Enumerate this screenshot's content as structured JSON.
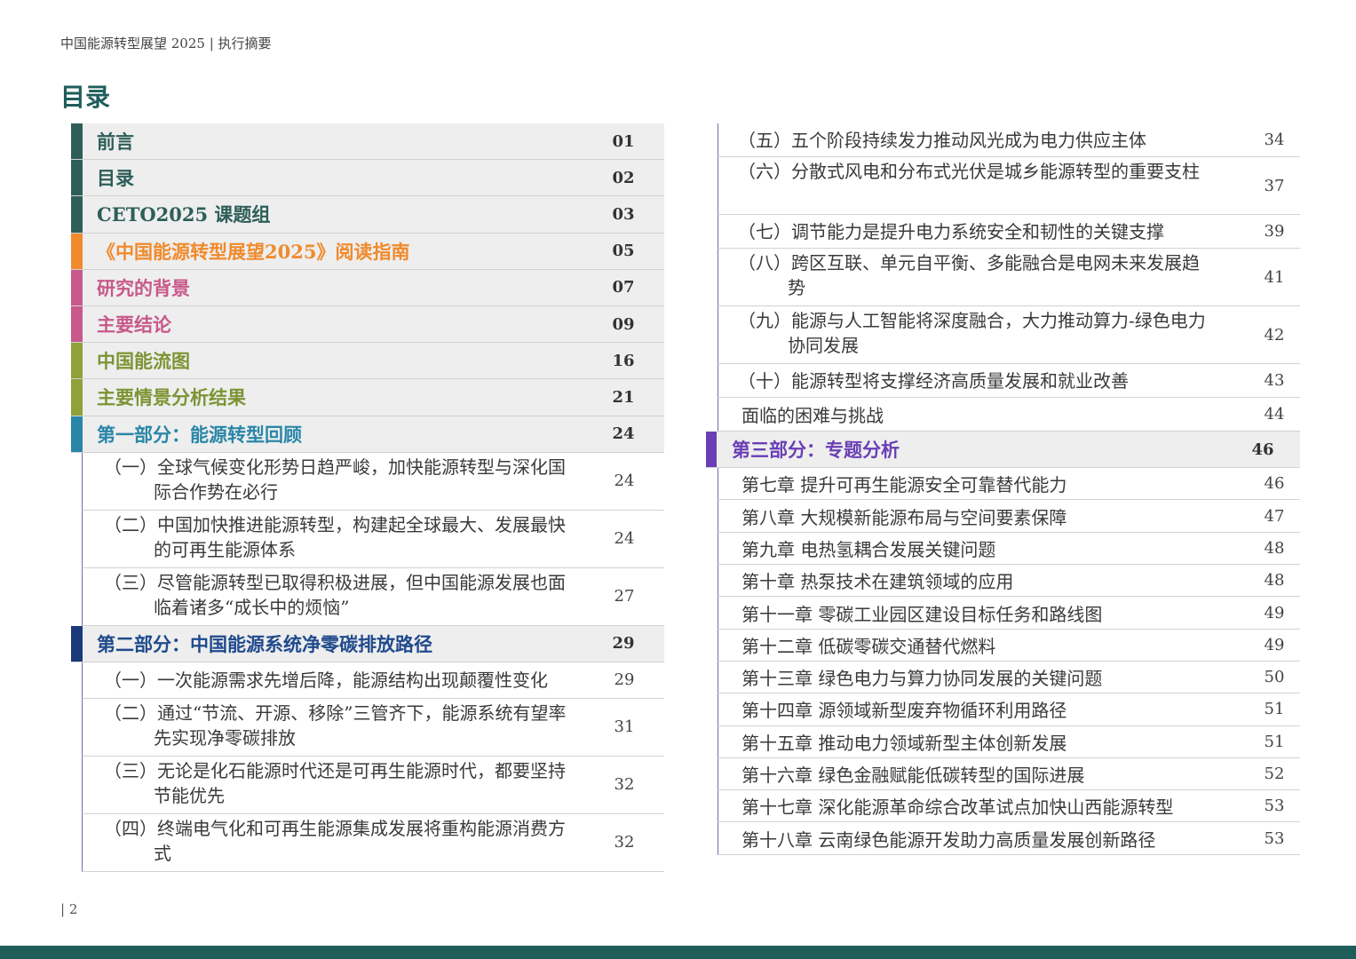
{
  "header": {
    "running_title": "中国能源转型展望 2025 | 执行摘要"
  },
  "toc_title": "目录",
  "left": [
    {
      "kind": "major",
      "title": "前言",
      "page": "01",
      "color": "#2e5e58",
      "text_color": "#2e5e58"
    },
    {
      "kind": "major",
      "title": "目录",
      "page": "02",
      "color": "#2e5e58",
      "text_color": "#2e5e58"
    },
    {
      "kind": "major",
      "title": "CETO2025 课题组",
      "page": "03",
      "color": "#2e5e58",
      "text_color": "#2e5e58"
    },
    {
      "kind": "major",
      "title": "《中国能源转型展望2025》阅读指南",
      "page": "05",
      "color": "#f08a2c",
      "text_color": "#f08a2c"
    },
    {
      "kind": "major",
      "title": "研究的背景",
      "page": "07",
      "color": "#c8598a",
      "text_color": "#c8598a"
    },
    {
      "kind": "major",
      "title": "主要结论",
      "page": "09",
      "color": "#c8598a",
      "text_color": "#c8598a"
    },
    {
      "kind": "major",
      "title": "中国能流图",
      "page": "16",
      "color": "#8ea13a",
      "text_color": "#7d9434"
    },
    {
      "kind": "major",
      "title": "主要情景分析结果",
      "page": "21",
      "color": "#8ea13a",
      "text_color": "#7d9434"
    },
    {
      "kind": "major",
      "title": "第一部分：能源转型回顾",
      "page": "24",
      "color": "#2a86a8",
      "text_color": "#2a86a8"
    },
    {
      "kind": "sub",
      "title": "（一）全球气候变化形势日趋严峻，加快能源转型与深化国际合作势在必行",
      "page": "24",
      "lines": 2
    },
    {
      "kind": "sub",
      "title": "（二）中国加快推进能源转型，构建起全球最大、发展最快的可再生能源体系",
      "page": "24",
      "lines": 2
    },
    {
      "kind": "sub",
      "title": "（三）尽管能源转型已取得积极进展，但中国能源发展也面临着诸多“成长中的烦恼”",
      "page": "27",
      "lines": 2
    },
    {
      "kind": "major",
      "title": "第二部分：中国能源系统净零碳排放路径",
      "page": "29",
      "color": "#1c3a7a",
      "text_color": "#1f4a8c"
    },
    {
      "kind": "sub",
      "title": "（一）一次能源需求先增后降，能源结构出现颠覆性变化",
      "page": "29",
      "lines": 1
    },
    {
      "kind": "sub",
      "title": "（二）通过“节流、开源、移除”三管齐下，能源系统有望率先实现净零碳排放",
      "page": "31",
      "lines": 2
    },
    {
      "kind": "sub",
      "title": "（三）无论是化石能源时代还是可再生能源时代，都要坚持节能优先",
      "page": "32",
      "lines": 2
    },
    {
      "kind": "sub",
      "title": "（四）终端电气化和可再生能源集成发展将重构能源消费方式",
      "page": "32",
      "lines": 2
    }
  ],
  "right": [
    {
      "kind": "sub",
      "title": "（五）五个阶段持续发力推动风光成为电力供应主体",
      "page": "34",
      "lines": 1
    },
    {
      "kind": "sub",
      "title": "（六）分散式风电和分布式光伏是城乡能源转型的重要支柱",
      "page": "37",
      "lines": 2
    },
    {
      "kind": "sub",
      "title": "（七）调节能力是提升电力系统安全和韧性的关键支撑",
      "page": "39",
      "lines": 1
    },
    {
      "kind": "sub",
      "title": "（八）跨区互联、单元自平衡、多能融合是电网未来发展趋势",
      "page": "41",
      "lines": 2
    },
    {
      "kind": "sub",
      "title": "（九）能源与人工智能将深度融合，大力推动算力-绿色电力协同发展",
      "page": "42",
      "lines": 2
    },
    {
      "kind": "sub",
      "title": "（十）能源转型将支撑经济高质量发展和就业改善",
      "page": "43",
      "lines": 1
    },
    {
      "kind": "plain",
      "title": "面临的困难与挑战",
      "page": "44"
    },
    {
      "kind": "major",
      "title": "第三部分：专题分析",
      "page": "46",
      "color": "#6a3fb5",
      "text_color": "#6a3fb5"
    },
    {
      "kind": "plain",
      "title": "第七章 提升可再生能源安全可靠替代能力",
      "page": "46"
    },
    {
      "kind": "plain",
      "title": "第八章 大规模新能源布局与空间要素保障",
      "page": "47"
    },
    {
      "kind": "plain",
      "title": "第九章 电热氢耦合发展关键问题",
      "page": "48"
    },
    {
      "kind": "plain",
      "title": "第十章  热泵技术在建筑领域的应用",
      "page": "48"
    },
    {
      "kind": "plain",
      "title": "第十一章 零碳工业园区建设目标任务和路线图",
      "page": "49"
    },
    {
      "kind": "plain",
      "title": "第十二章 低碳零碳交通替代燃料",
      "page": "49"
    },
    {
      "kind": "plain",
      "title": "第十三章 绿色电力与算力协同发展的关键问题",
      "page": "50"
    },
    {
      "kind": "plain",
      "title": "第十四章 源领域新型废弃物循环利用路径",
      "page": "51"
    },
    {
      "kind": "plain",
      "title": "第十五章 推动电力领域新型主体创新发展",
      "page": "51"
    },
    {
      "kind": "plain",
      "title": "第十六章 绿色金融赋能低碳转型的国际进展",
      "page": "52"
    },
    {
      "kind": "plain",
      "title": "第十七章 深化能源革命综合改革试点加快山西能源转型",
      "page": "53"
    },
    {
      "kind": "plain",
      "title": "第十八章 云南绿色能源开发助力高质量发展创新路径",
      "page": "53"
    }
  ],
  "footer": {
    "page_number": "| 2",
    "band_color": "#1f5d5a"
  }
}
